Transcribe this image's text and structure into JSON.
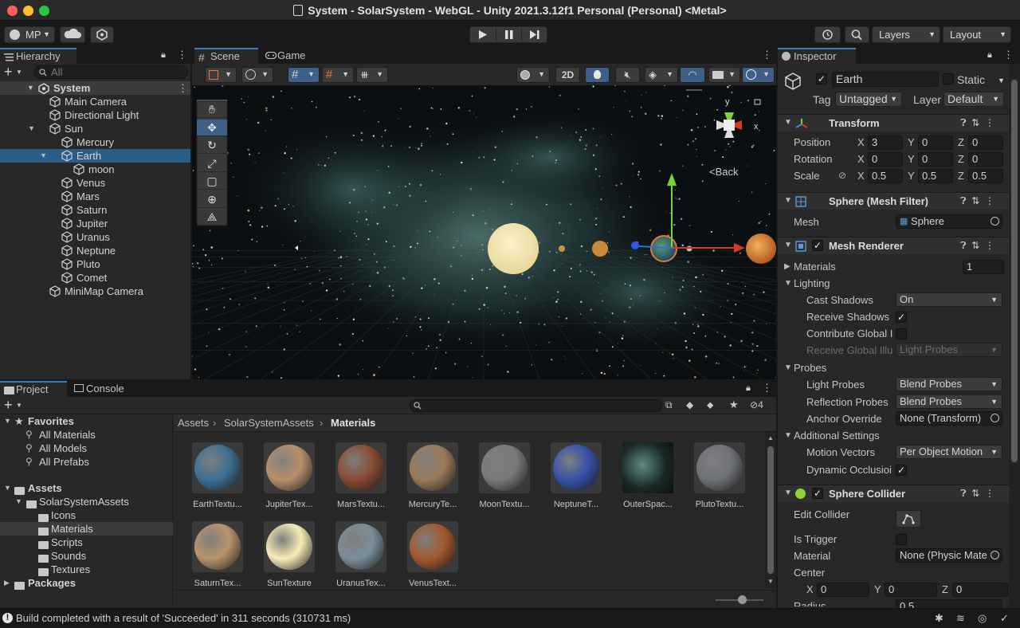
{
  "window": {
    "title": "System - SolarSystem - WebGL - Unity 2021.3.12f1 Personal (Personal) <Metal>",
    "traffic_colors": [
      "#fe5f57",
      "#febc2e",
      "#28c840"
    ]
  },
  "toolbar": {
    "account": "MP",
    "layers": "Layers",
    "layout": "Layout"
  },
  "hierarchy": {
    "tab": "Hierarchy",
    "search_placeholder": "All",
    "scene": "System",
    "items": [
      {
        "label": "Main Camera",
        "indent": 1,
        "arrow": ""
      },
      {
        "label": "Directional Light",
        "indent": 1,
        "arrow": ""
      },
      {
        "label": "Sun",
        "indent": 1,
        "arrow": "▼"
      },
      {
        "label": "Mercury",
        "indent": 2,
        "arrow": ""
      },
      {
        "label": "Earth",
        "indent": 2,
        "arrow": "▼"
      },
      {
        "label": "moon",
        "indent": 3,
        "arrow": ""
      },
      {
        "label": "Venus",
        "indent": 2,
        "arrow": ""
      },
      {
        "label": "Mars",
        "indent": 2,
        "arrow": ""
      },
      {
        "label": "Saturn",
        "indent": 2,
        "arrow": ""
      },
      {
        "label": "Jupiter",
        "indent": 2,
        "arrow": ""
      },
      {
        "label": "Uranus",
        "indent": 2,
        "arrow": ""
      },
      {
        "label": "Neptune",
        "indent": 2,
        "arrow": ""
      },
      {
        "label": "Pluto",
        "indent": 2,
        "arrow": ""
      },
      {
        "label": "Comet",
        "indent": 2,
        "arrow": ""
      },
      {
        "label": "MiniMap Camera",
        "indent": 1,
        "arrow": ""
      }
    ],
    "selected": "Earth"
  },
  "scene": {
    "tab_scene": "Scene",
    "tab_game": "Game",
    "btn_2d": "2D",
    "gizmo_back": "Back",
    "axis_x": "x",
    "axis_y": "y"
  },
  "inspector": {
    "tab": "Inspector",
    "object_name": "Earth",
    "static_label": "Static",
    "tag_label": "Tag",
    "tag_value": "Untagged",
    "layer_label": "Layer",
    "layer_value": "Default",
    "transform": {
      "title": "Transform",
      "position_label": "Position",
      "position": [
        "3",
        "0",
        "0"
      ],
      "rotation_label": "Rotation",
      "rotation": [
        "0",
        "0",
        "0"
      ],
      "scale_label": "Scale",
      "scale": [
        "0.5",
        "0.5",
        "0.5"
      ]
    },
    "mesh_filter": {
      "title": "Sphere (Mesh Filter)",
      "mesh_label": "Mesh",
      "mesh_value": "Sphere"
    },
    "mesh_renderer": {
      "title": "Mesh Renderer",
      "materials_label": "Materials",
      "materials_count": "1",
      "lighting_label": "Lighting",
      "cast_shadows_label": "Cast Shadows",
      "cast_shadows_value": "On",
      "receive_shadows_label": "Receive Shadows",
      "contribute_gi_label": "Contribute Global I",
      "receive_gi_label": "Receive Global Illu",
      "receive_gi_value": "Light Probes",
      "probes_label": "Probes",
      "light_probes_label": "Light Probes",
      "light_probes_value": "Blend Probes",
      "reflection_probes_label": "Reflection Probes",
      "reflection_probes_value": "Blend Probes",
      "anchor_override_label": "Anchor Override",
      "anchor_override_value": "None (Transform)",
      "additional_label": "Additional Settings",
      "motion_vectors_label": "Motion Vectors",
      "motion_vectors_value": "Per Object Motion",
      "dynamic_occlusion_label": "Dynamic Occlusioi"
    },
    "sphere_collider": {
      "title": "Sphere Collider",
      "edit_collider_label": "Edit Collider",
      "is_trigger_label": "Is Trigger",
      "material_label": "Material",
      "material_value": "None (Physic Mate",
      "center_label": "Center",
      "center": [
        "0",
        "0",
        "0"
      ],
      "radius_label": "Radius",
      "radius_value": "0.5"
    }
  },
  "project": {
    "tab_project": "Project",
    "tab_console": "Console",
    "hidden_count": "4",
    "favorites_label": "Favorites",
    "favorites": [
      "All Materials",
      "All Models",
      "All Prefabs"
    ],
    "assets_label": "Assets",
    "tree": [
      "SolarSystemAssets",
      "Icons",
      "Materials",
      "Scripts",
      "Sounds",
      "Textures"
    ],
    "packages_label": "Packages",
    "breadcrumb": [
      "Assets",
      "SolarSystemAssets",
      "Materials"
    ],
    "assets": [
      {
        "name": "EarthTextu...",
        "color": "#3e6f94"
      },
      {
        "name": "JupiterTex...",
        "color": "#b9906a"
      },
      {
        "name": "MarsTextu...",
        "color": "#8a4a32"
      },
      {
        "name": "MercuryTe...",
        "color": "#9c7a58"
      },
      {
        "name": "MoonTextu...",
        "color": "#7a7a7a"
      },
      {
        "name": "NeptuneT...",
        "color": "#3552a8"
      },
      {
        "name": "OuterSpac...",
        "color": "#1a2a26"
      },
      {
        "name": "PlutoTextu...",
        "color": "#6f7278"
      },
      {
        "name": "SaturnTex...",
        "color": "#b8946c"
      },
      {
        "name": "SunTexture",
        "color": "#f6ecb8"
      },
      {
        "name": "UranusTex...",
        "color": "#7a8e9a"
      },
      {
        "name": "VenusText...",
        "color": "#a4582e"
      }
    ]
  },
  "status": {
    "message": "Build completed with a result of 'Succeeded' in 311 seconds (310731 ms)"
  }
}
